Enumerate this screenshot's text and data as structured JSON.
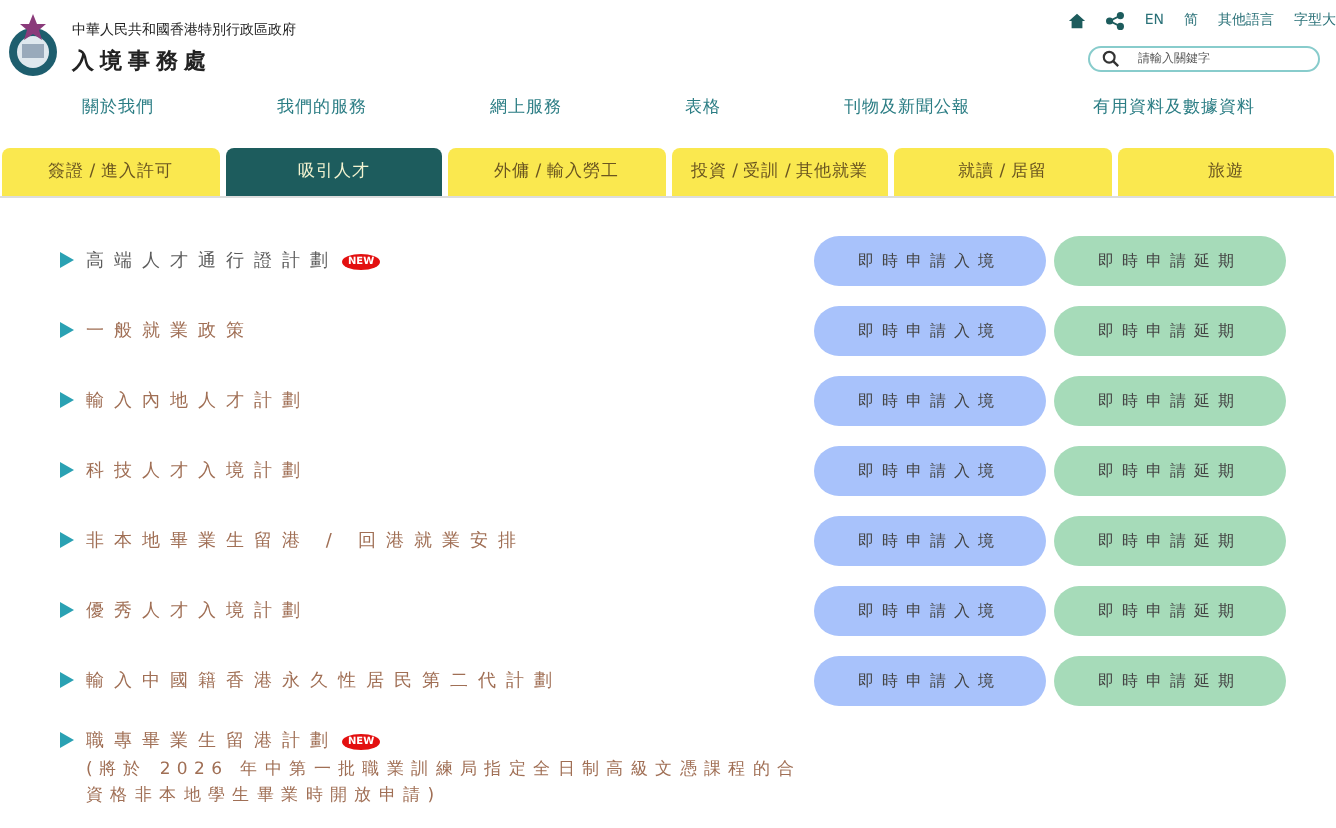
{
  "header": {
    "government": "中華人民共和國香港特別行政區政府",
    "department": "入境事務處"
  },
  "utility_links": [
    "EN",
    "简",
    "其他語言",
    "字型大"
  ],
  "search": {
    "placeholder": "請輸入關鍵字"
  },
  "nav": [
    "關於我們",
    "我們的服務",
    "網上服務",
    "表格",
    "刊物及新聞公報",
    "有用資料及數據資料"
  ],
  "tabs": [
    {
      "label": "簽證 / 進入許可",
      "selected": false
    },
    {
      "label": "吸引人才",
      "selected": true
    },
    {
      "label": "外傭 / 輸入勞工",
      "selected": false
    },
    {
      "label": "投資 / 受訓 / 其他就業",
      "selected": false
    },
    {
      "label": "就讀 / 居留",
      "selected": false
    },
    {
      "label": "旅遊",
      "selected": false
    }
  ],
  "schemes": [
    {
      "title": "高端人才通行證計劃",
      "color": "#5c5c5c",
      "badge": "NEW",
      "buttons": [
        {
          "label": "即時申請入境",
          "kind": "entry"
        },
        {
          "label": "即時申請延期",
          "kind": "extension"
        }
      ]
    },
    {
      "title": "一般就業政策",
      "color": "#a06f55",
      "buttons": [
        {
          "label": "即時申請入境",
          "kind": "entry"
        },
        {
          "label": "即時申請延期",
          "kind": "extension"
        }
      ]
    },
    {
      "title": "輸入內地人才計劃",
      "color": "#a06f55",
      "buttons": [
        {
          "label": "即時申請入境",
          "kind": "entry"
        },
        {
          "label": "即時申請延期",
          "kind": "extension"
        }
      ]
    },
    {
      "title": "科技人才入境計劃",
      "color": "#a06f55",
      "buttons": [
        {
          "label": "即時申請入境",
          "kind": "entry"
        },
        {
          "label": "即時申請延期",
          "kind": "extension"
        }
      ]
    },
    {
      "title": "非本地畢業生留港 / 回港就業安排",
      "color": "#a06f55",
      "buttons": [
        {
          "label": "即時申請入境",
          "kind": "entry"
        },
        {
          "label": "即時申請延期",
          "kind": "extension"
        }
      ]
    },
    {
      "title": "優秀人才入境計劃",
      "color": "#a06f55",
      "buttons": [
        {
          "label": "即時申請入境",
          "kind": "entry"
        },
        {
          "label": "即時申請延期",
          "kind": "extension"
        }
      ]
    },
    {
      "title": "輸入中國籍香港永久性居民第二代計劃",
      "color": "#a06f55",
      "buttons": [
        {
          "label": "即時申請入境",
          "kind": "entry"
        },
        {
          "label": "即時申請延期",
          "kind": "extension"
        }
      ]
    },
    {
      "title": "職專畢業生留港計劃",
      "color": "#a06f55",
      "badge": "NEW",
      "note": "(將於 2026 年中第一批職業訓練局指定全日制高級文憑課程的合資格非本地學生畢業時開放申請)"
    }
  ]
}
